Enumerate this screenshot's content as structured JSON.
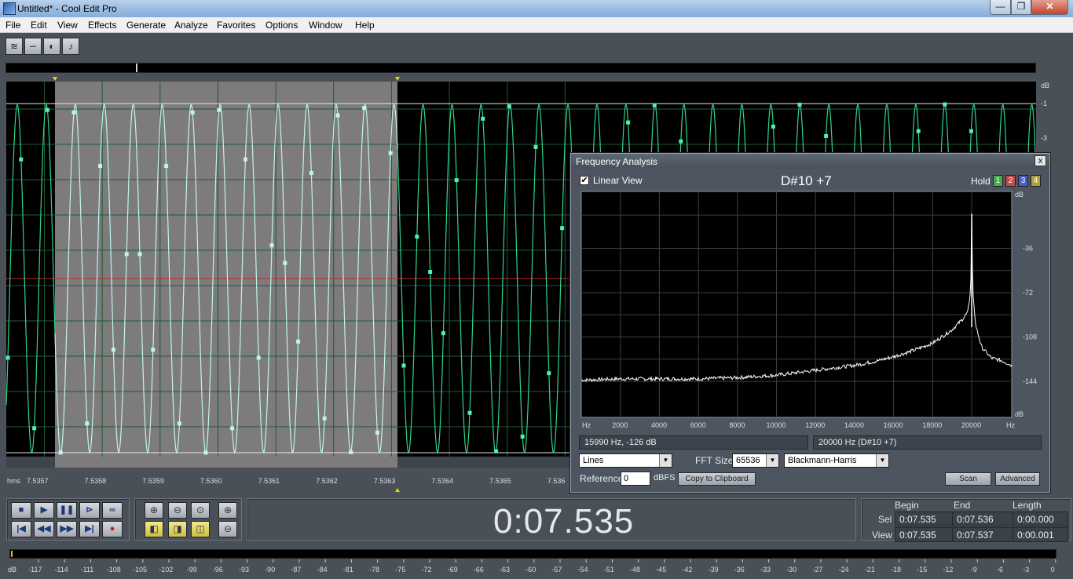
{
  "window": {
    "title": "Untitled* - Cool Edit Pro",
    "controls": {
      "minimize": "—",
      "maximize": "❐",
      "close": "✕"
    }
  },
  "menu": [
    "File",
    "Edit",
    "View",
    "Effects",
    "Generate",
    "Analyze",
    "Favorites",
    "Options",
    "Window",
    "Help"
  ],
  "toolbar": {
    "icons": [
      "multitrack-icon",
      "loop-icon",
      "cd-icon",
      "note-icon"
    ]
  },
  "waveform": {
    "time_unit": "hms",
    "time_ticks": [
      "7.5357",
      "7.5358",
      "7.5359",
      "7.5360",
      "7.5361",
      "7.5362",
      "7.5363",
      "7.5364",
      "7.5365",
      "7.536"
    ],
    "db_unit": "dB",
    "db_ticks": [
      "-1",
      "-3"
    ],
    "selection": {
      "start": "7.53575",
      "end": "7.5363"
    },
    "colors": {
      "wave": "#2fd58a",
      "selected_wave": "#bff5ea",
      "selection_bg": "#7d7b7c",
      "background": "#000000",
      "centerline": "#cc2222"
    }
  },
  "freq_analysis": {
    "title": "Frequency Analysis",
    "close": "x",
    "linear_view_checked": true,
    "linear_view_label": "Linear View",
    "note": "D#10 +7",
    "hold_label": "Hold",
    "hold_buttons": [
      {
        "label": "1",
        "color": "#4aa84e"
      },
      {
        "label": "2",
        "color": "#c04a4a"
      },
      {
        "label": "3",
        "color": "#4a5cc0"
      },
      {
        "label": "4",
        "color": "#b0a040"
      }
    ],
    "x_unit": "Hz",
    "x_ticks": [
      "2000",
      "4000",
      "6000",
      "8000",
      "10000",
      "12000",
      "14000",
      "16000",
      "18000",
      "20000"
    ],
    "y_unit": "dB",
    "y_ticks": [
      "-36",
      "-72",
      "-108",
      "-144"
    ],
    "cursor_readout": "15990 Hz,  -126 dB",
    "peak_readout": "20000 Hz (D#10 +7)",
    "display_mode": "Lines",
    "fft_size_label": "FFT Size",
    "fft_size": "65536",
    "window_function": "Blackmann-Harris",
    "reference_label": "Reference",
    "reference_value": "0",
    "reference_unit": "dBFS",
    "copy_label": "Copy to Clipboard",
    "scan_label": "Scan",
    "advanced_label": "Advanced"
  },
  "chart_data": {
    "type": "line",
    "x_unit": "Hz",
    "y_unit": "dB",
    "xlim": [
      0,
      22050
    ],
    "ylim": [
      -160,
      0
    ],
    "x": [
      0,
      2000,
      4000,
      6000,
      8000,
      10000,
      12000,
      13000,
      14000,
      15000,
      16000,
      17000,
      18000,
      19000,
      19500,
      19800,
      19950,
      20000,
      20050,
      20200,
      20500,
      21000,
      21500,
      22050
    ],
    "y": [
      -143,
      -142,
      -142,
      -142,
      -141,
      -139,
      -135,
      -133,
      -131,
      -128,
      -124,
      -119,
      -113,
      -102,
      -94,
      -88,
      -70,
      -8,
      -70,
      -98,
      -116,
      -125,
      -127,
      -131
    ],
    "grid": true
  },
  "transport": {
    "buttons": [
      "stop-icon",
      "play-icon",
      "pause-icon",
      "play-to-end-icon",
      "loop-play-icon",
      "go-to-start-icon",
      "rewind-icon",
      "fast-forward-icon",
      "go-to-end-icon",
      "record-icon"
    ],
    "zoom_buttons": [
      "zoom-in-horizontal-icon",
      "zoom-out-horizontal-icon",
      "zoom-full-icon",
      "zoom-in-vertical-icon",
      "zoom-left-icon",
      "zoom-right-icon",
      "zoom-selection-icon",
      "zoom-out-vertical-icon"
    ]
  },
  "time_display": "0:07.535",
  "selection_panel": {
    "headers": {
      "begin": "Begin",
      "end": "End",
      "length": "Length"
    },
    "sel": {
      "label": "Sel",
      "begin": "0:07.535",
      "end": "0:07.536",
      "length": "0:00.000"
    },
    "view": {
      "label": "View",
      "begin": "0:07.535",
      "end": "0:07.537",
      "length": "0:00.001"
    }
  },
  "level_meter": {
    "unit": "dB",
    "ticks": [
      "-117",
      "-114",
      "-111",
      "-108",
      "-105",
      "-102",
      "-99",
      "-96",
      "-93",
      "-90",
      "-87",
      "-84",
      "-81",
      "-78",
      "-75",
      "-72",
      "-69",
      "-66",
      "-63",
      "-60",
      "-57",
      "-54",
      "-51",
      "-48",
      "-45",
      "-42",
      "-39",
      "-36",
      "-33",
      "-30",
      "-27",
      "-24",
      "-21",
      "-18",
      "-15",
      "-12",
      "-9",
      "-6",
      "-3",
      "0"
    ]
  }
}
